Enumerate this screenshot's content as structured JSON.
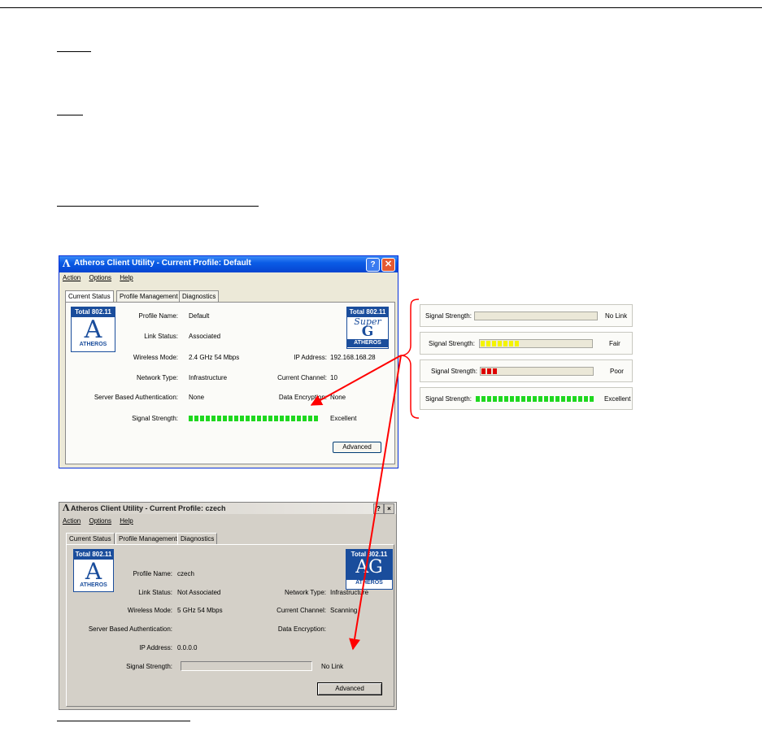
{
  "window1": {
    "title": "Atheros Client Utility - Current Profile: Default",
    "menu": [
      "Action",
      "Options",
      "Help"
    ],
    "tabs": [
      "Current Status",
      "Profile Management",
      "Diagnostics"
    ],
    "logo": {
      "top": "Total 802.11",
      "bottom": "ATHEROS"
    },
    "logo2": {
      "top": "Total 802.11",
      "script": "Super",
      "letter": "G",
      "bottom": "ATHEROS"
    },
    "profile_name": {
      "label": "Profile Name:",
      "value": "Default"
    },
    "link_status": {
      "label": "Link Status:",
      "value": "Associated"
    },
    "wireless_mode": {
      "label": "Wireless Mode:",
      "value": "2.4 GHz 54 Mbps"
    },
    "ip_address": {
      "label": "IP Address:",
      "value": "192.168.168.28"
    },
    "network_type": {
      "label": "Network Type:",
      "value": "Infrastructure"
    },
    "current_channel": {
      "label": "Current Channel:",
      "value": "10"
    },
    "server_auth": {
      "label": "Server Based Authentication:",
      "value": "None"
    },
    "data_encryption": {
      "label": "Data Encryption:",
      "value": "None"
    },
    "signal": {
      "label": "Signal Strength:",
      "value": "Excellent",
      "level": 1.0
    },
    "advanced_label": "Advanced"
  },
  "window2": {
    "title": "Atheros Client Utility - Current Profile: czech",
    "menu": [
      "Action",
      "Options",
      "Help"
    ],
    "tabs": [
      "Current Status",
      "Profile Management",
      "Diagnostics"
    ],
    "logo": {
      "top": "Total 802.11",
      "bottom": "ATHEROS"
    },
    "logo2": {
      "top": "Total 802.11",
      "letters": "AG",
      "bottom": "ATHEROS"
    },
    "profile_name": {
      "label": "Profile Name:",
      "value": "czech"
    },
    "link_status": {
      "label": "Link Status:",
      "value": "Not Associated"
    },
    "network_type": {
      "label": "Network Type:",
      "value": "Infrastructure"
    },
    "wireless_mode": {
      "label": "Wireless Mode:",
      "value": "5 GHz 54 Mbps"
    },
    "current_channel": {
      "label": "Current Channel:",
      "value": "Scanning"
    },
    "server_auth": {
      "label": "Server Based Authentication:"
    },
    "data_encryption": {
      "label": "Data Encryption:"
    },
    "ip_address": {
      "label": "IP Address:",
      "value": "0.0.0.0"
    },
    "signal": {
      "label": "Signal Strength:",
      "value": "No Link",
      "level": 0
    },
    "advanced_label": "Advanced"
  },
  "signal_samples": [
    {
      "label": "Signal Strength:",
      "value": "No Link",
      "level": 0,
      "color": "#00cc00"
    },
    {
      "label": "Signal Strength:",
      "value": "Fair",
      "level": 0.35,
      "color": "#f4f400"
    },
    {
      "label": "Signal Strength:",
      "value": "Poor",
      "level": 0.17,
      "color": "#dd0000"
    },
    {
      "label": "Signal Strength:",
      "value": "Excellent",
      "level": 1.0,
      "color": "#1fd81f"
    }
  ],
  "colors": {
    "signal_green": "#1fd81f",
    "arrow": "#ff0000",
    "brace": "#ff0000"
  }
}
